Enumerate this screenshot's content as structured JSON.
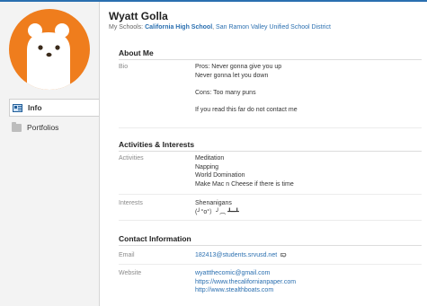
{
  "profile": {
    "name": "Wyatt Golla",
    "schools_prefix": "My Schools:",
    "school_primary": "California High School",
    "school_separator": ",",
    "school_district": "San Ramon Valley Unified School District"
  },
  "sidebar": {
    "items": [
      {
        "label": "Info",
        "icon": "info-icon",
        "active": true
      },
      {
        "label": "Portfolios",
        "icon": "folder-icon",
        "active": false
      }
    ]
  },
  "about": {
    "title": "About Me",
    "bio_label": "Bio",
    "bio_lines": [
      "Pros: Never gonna give you up",
      "Never gonna let you down",
      "",
      "Cons: Too many puns",
      "",
      "If you read this far do not contact me"
    ]
  },
  "activities": {
    "title": "Activities & Interests",
    "activities_label": "Activities",
    "activities_lines": [
      "Meditation",
      "Napping",
      "World Domination",
      "Make Mac n Cheese if there is time"
    ],
    "interests_label": "Interests",
    "interests_lines": [
      "Shenanigans",
      "(╯°o°）╯︵ ┻━┻"
    ]
  },
  "contact": {
    "title": "Contact Information",
    "email_label": "Email",
    "email": "182413@students.srvusd.net",
    "website_label": "Website",
    "websites": [
      "wyattthecomic@gmail.com",
      "https://www.thecalifornianpaper.com",
      "http://www.stealthboats.com"
    ]
  },
  "colors": {
    "avatar_bg": "#ef7d1d",
    "link": "#2a6fb0"
  }
}
